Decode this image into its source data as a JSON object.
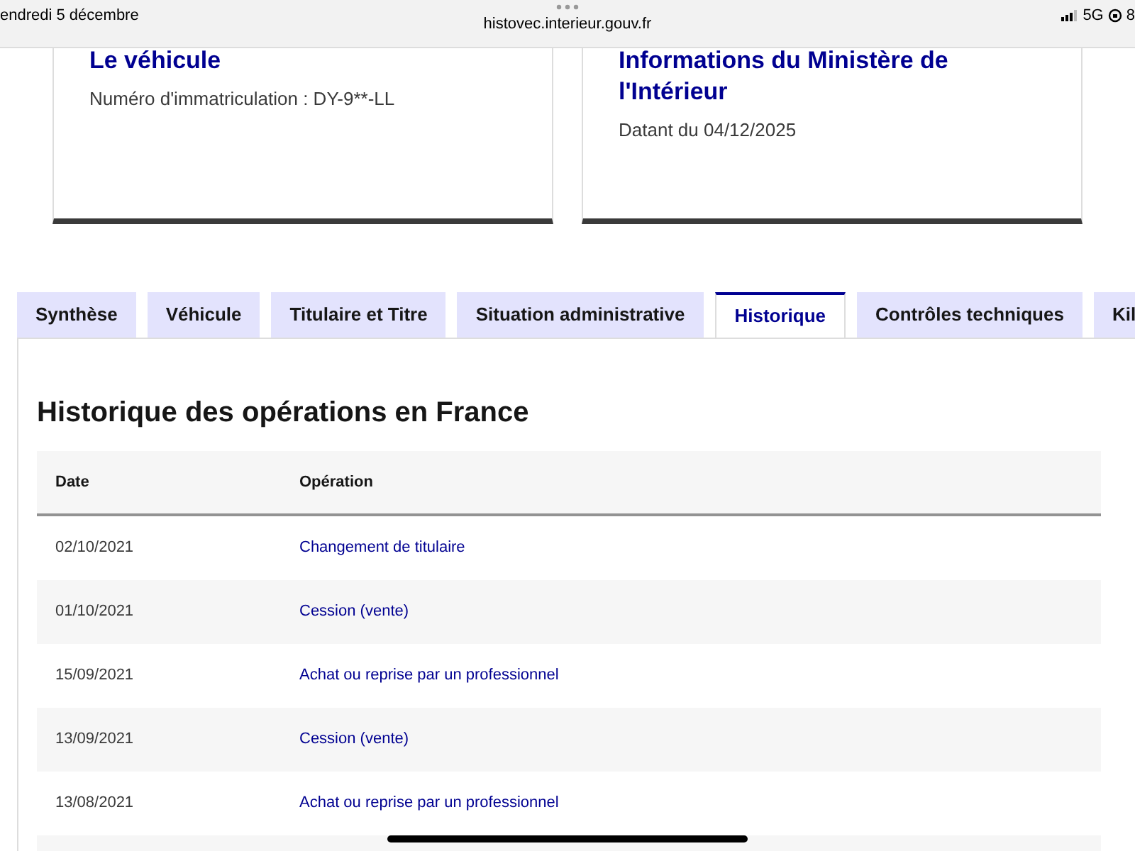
{
  "status_bar": {
    "date": "endredi 5 décembre",
    "address": "histovec.interieur.gouv.fr",
    "network": "5G",
    "battery": "8"
  },
  "cards": [
    {
      "title": "Le véhicule",
      "text": "Numéro d'immatriculation : DY-9**-LL"
    },
    {
      "title": "Informations du Ministère de l'Intérieur",
      "text": "Datant du 04/12/2025"
    }
  ],
  "tabs": [
    {
      "label": "Synthèse",
      "selected": false
    },
    {
      "label": "Véhicule",
      "selected": false
    },
    {
      "label": "Titulaire et Titre",
      "selected": false
    },
    {
      "label": "Situation administrative",
      "selected": false
    },
    {
      "label": "Historique",
      "selected": true
    },
    {
      "label": "Contrôles techniques",
      "selected": false
    },
    {
      "label": "Kil",
      "selected": false
    }
  ],
  "panel": {
    "heading": "Historique des opérations en France",
    "table": {
      "columns": [
        "Date",
        "Opération"
      ],
      "rows": [
        [
          "02/10/2021",
          "Changement de titulaire"
        ],
        [
          "01/10/2021",
          "Cession (vente)"
        ],
        [
          "15/09/2021",
          "Achat ou reprise par un professionnel"
        ],
        [
          "13/09/2021",
          "Cession (vente)"
        ],
        [
          "13/08/2021",
          "Achat ou reprise par un professionnel"
        ]
      ]
    }
  }
}
